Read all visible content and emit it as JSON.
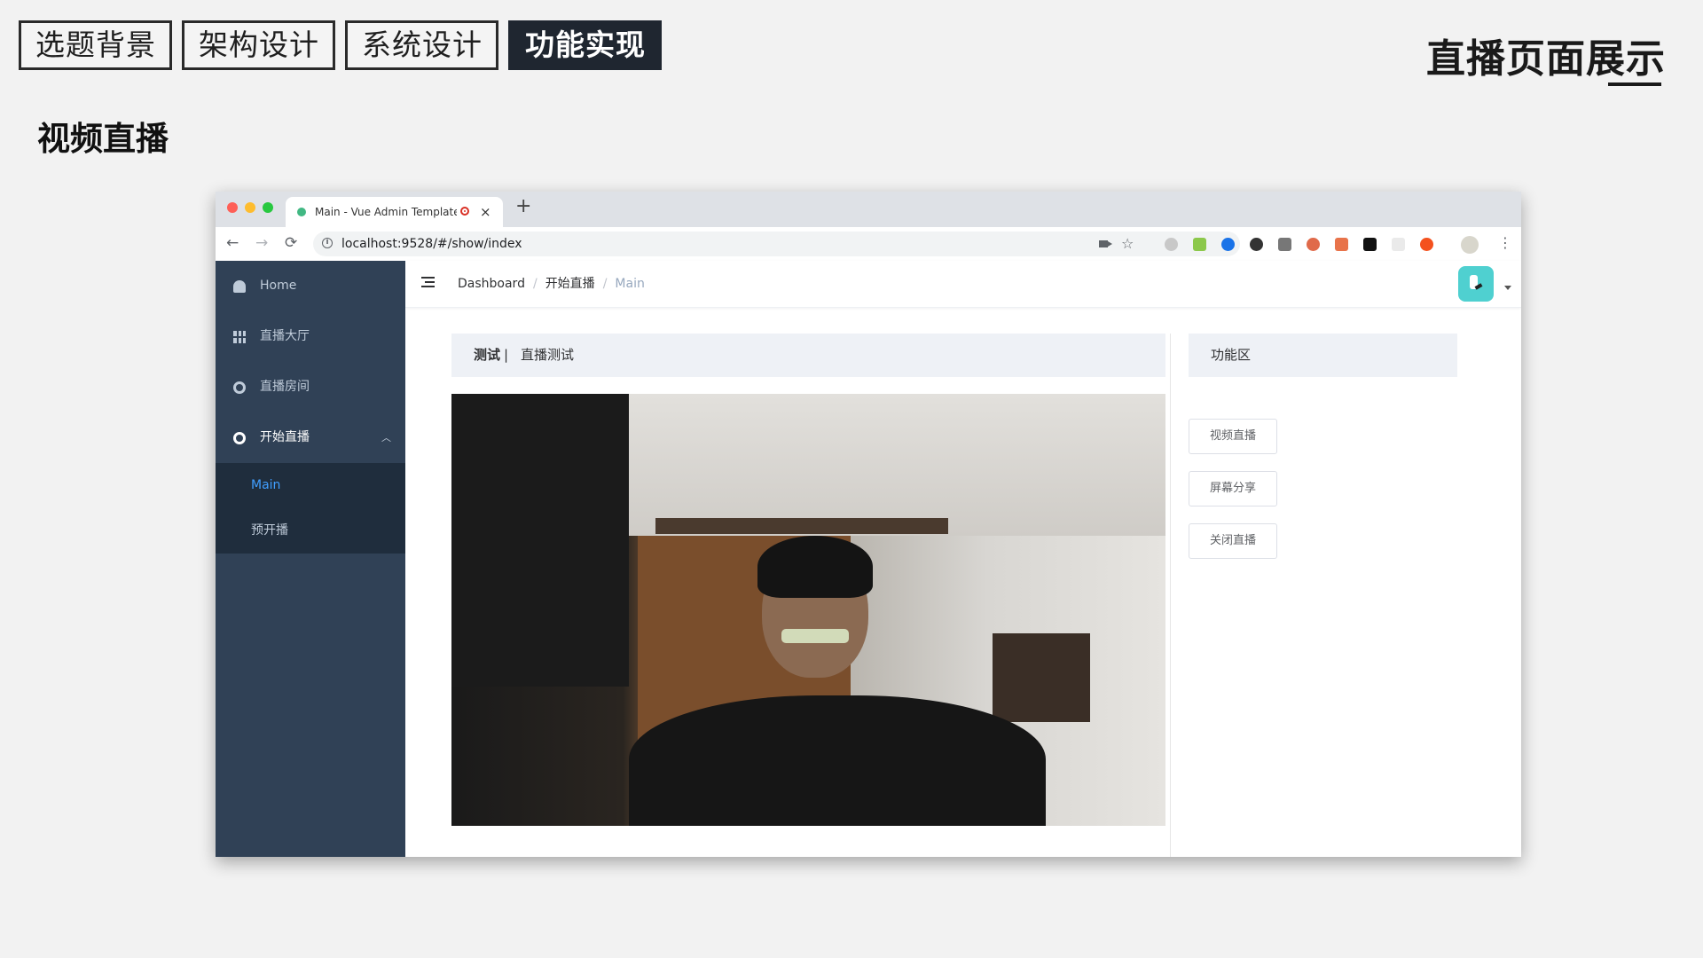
{
  "slide": {
    "tabs": [
      "选题背景",
      "架构设计",
      "系统设计",
      "功能实现"
    ],
    "active_tab": "功能实现",
    "title": "直播页面展示",
    "section_heading": "视频直播"
  },
  "browser": {
    "tab_title": "Main - Vue Admin Template",
    "new_tab": "+",
    "close_tab": "×",
    "url": "localhost:9528/#/show/index",
    "nav": {
      "back": "←",
      "forward": "→",
      "reload": "⟳"
    },
    "star": "☆",
    "menu": "⋮",
    "colors": {
      "tabbar": "#dee1e6",
      "close": "#fe5f57",
      "minimize": "#febc2e",
      "zoom": "#28c840"
    }
  },
  "sidebar": {
    "items": [
      {
        "label": "Home",
        "icon": "dashboard-icon"
      },
      {
        "label": "直播大厅",
        "icon": "grid-icon"
      },
      {
        "label": "直播房间",
        "icon": "gear-icon"
      },
      {
        "label": "开始直播",
        "icon": "gear-icon",
        "expanded": true
      }
    ],
    "chevron": "︿",
    "submenu": [
      {
        "label": "Main",
        "active": true
      },
      {
        "label": "预开播"
      }
    ],
    "colors": {
      "background": "#304156",
      "submenu": "#1f2d3d",
      "active": "#409eff"
    }
  },
  "navbar": {
    "breadcrumb": [
      "Dashboard",
      "开始直播",
      "Main"
    ],
    "separator": "/"
  },
  "content": {
    "header_bold": "测试",
    "header_sep": "|",
    "header_sub": "直播测试",
    "side_title": "功能区",
    "buttons": [
      "视频直播",
      "屏幕分享",
      "关闭直播"
    ]
  }
}
